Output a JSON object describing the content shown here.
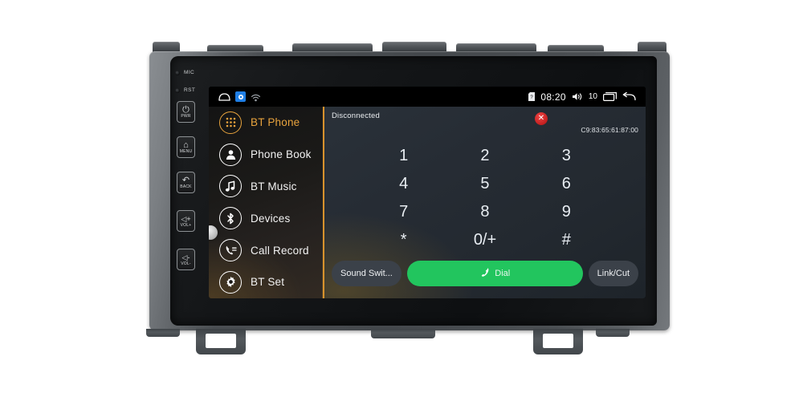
{
  "device": {
    "name": "android-car-head-unit",
    "hardware_buttons": [
      {
        "id": "mic",
        "label": "MIC",
        "type": "indicator"
      },
      {
        "id": "rst",
        "label": "RST",
        "type": "indicator"
      },
      {
        "id": "pwr",
        "label": "PWR",
        "glyph": "⏻",
        "icon": "power-icon"
      },
      {
        "id": "menu",
        "label": "MENU",
        "glyph": "⌂",
        "icon": "home-icon"
      },
      {
        "id": "back",
        "label": "BACK",
        "glyph": "↶",
        "icon": "back-arrow-icon"
      },
      {
        "id": "volup",
        "label": "VOL+",
        "glyph": "◁+",
        "icon": "volume-up-icon"
      },
      {
        "id": "voldown",
        "label": "VOL-",
        "glyph": "◁-",
        "icon": "volume-down-icon"
      }
    ]
  },
  "statusbar": {
    "home_icon": "home-icon",
    "app_icon": "blue-app-icon",
    "wifi_icon": "wifi-icon",
    "sd_icon": "sd-card-icon",
    "time": "08:20",
    "volume_icon": "volume-icon",
    "volume_level": "10",
    "recents_icon": "recents-icon",
    "back_icon": "back-icon"
  },
  "sidebar": {
    "items": [
      {
        "label": "BT Phone",
        "icon": "keypad-icon",
        "active": true
      },
      {
        "label": "Phone Book",
        "icon": "contact-icon",
        "active": false
      },
      {
        "label": "BT Music",
        "icon": "music-note-icon",
        "active": false
      },
      {
        "label": "Devices",
        "icon": "bluetooth-icon",
        "active": false
      },
      {
        "label": "Call Record",
        "icon": "call-log-icon",
        "active": false
      },
      {
        "label": "BT Set",
        "icon": "gear-icon",
        "active": false
      }
    ],
    "scroll_handle": "scroll-knob"
  },
  "panel": {
    "status": "Disconnected",
    "close_icon": "close-icon",
    "mac_address": "C9:83:65:61:87:00",
    "keypad": [
      "1",
      "2",
      "3",
      "4",
      "5",
      "6",
      "7",
      "8",
      "9",
      "*",
      "0/+",
      "#"
    ],
    "actions": {
      "sound_switch": "Sound Swit...",
      "dial": "Dial",
      "dial_icon": "phone-handset-icon",
      "link_cut": "Link/Cut"
    }
  },
  "colors": {
    "accent_orange": "#e8a33d",
    "divider_orange": "#d8922c",
    "dial_green": "#22c55e",
    "close_red": "#ef4444",
    "panel_bg": "#262c34",
    "sidebar_bg": "#1b1a18",
    "statusbar_bg": "#000000",
    "app_icon_blue": "#1f7fe6"
  }
}
